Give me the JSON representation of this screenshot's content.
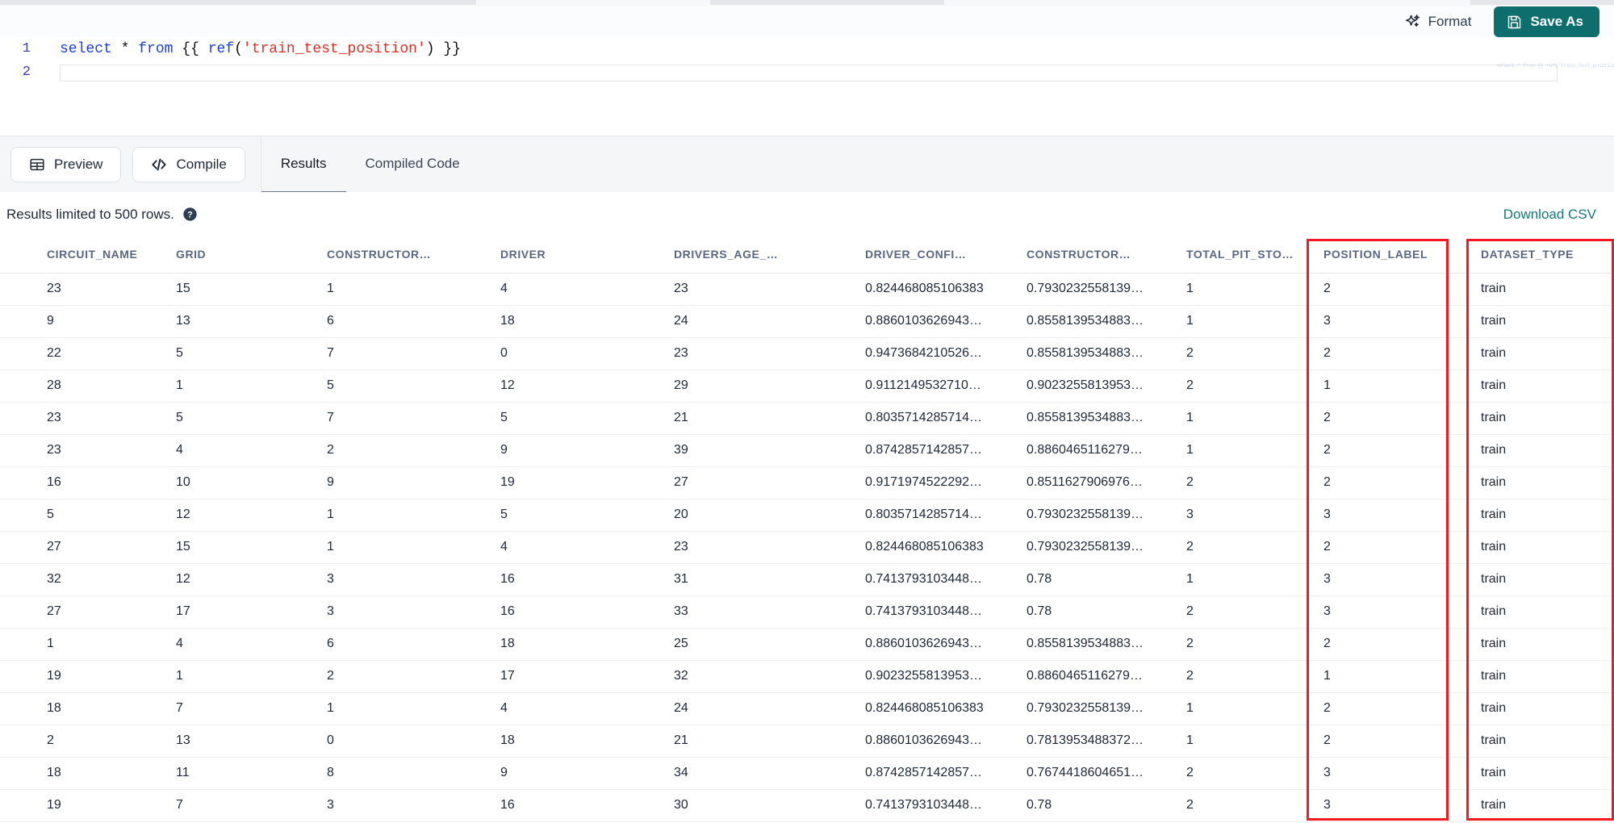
{
  "editor": {
    "toolbar": {
      "format_label": "Format",
      "format_icon": "sparkle-icon",
      "save_as_label": "Save As",
      "save_as_icon": "floppy-disk-icon",
      "accent_color": "#0e6e6e"
    },
    "lines": [
      {
        "number": "1"
      },
      {
        "number": "2"
      }
    ],
    "sql": {
      "kw_select": "select",
      "op_star": "*",
      "kw_from": "from",
      "open_brace": "{{ ",
      "fn_ref": "ref",
      "paren_open": "(",
      "str_arg": "'train_test_position'",
      "paren_close": ")",
      "close_brace": " }}",
      "full_text": "select * from {{ ref('train_test_position') }}",
      "line2_value": ""
    }
  },
  "actions": {
    "preview_label": "Preview",
    "preview_icon": "table-grid-icon",
    "compile_label": "Compile",
    "compile_icon": "code-brackets-icon"
  },
  "tabs": [
    {
      "label": "Results",
      "active": true
    },
    {
      "label": "Compiled Code",
      "active": false
    }
  ],
  "results_info": {
    "limit_text": "Results limited to 500 rows.",
    "help_icon": "help-circle-icon",
    "download_label": "Download CSV",
    "download_color": "#17757a"
  },
  "table": {
    "columns": [
      "CIRCUIT_NAME",
      "GRID",
      "CONSTRUCTOR…",
      "DRIVER",
      "DRIVERS_AGE_…",
      "DRIVER_CONFI…",
      "CONSTRUCTOR…",
      "TOTAL_PIT_STO…",
      "POSITION_LABEL",
      "DATASET_TYPE"
    ],
    "rows": [
      [
        "23",
        "15",
        "1",
        "4",
        "23",
        "0.824468085106383",
        "0.7930232558139…",
        "1",
        "2",
        "train"
      ],
      [
        "9",
        "13",
        "6",
        "18",
        "24",
        "0.8860103626943…",
        "0.8558139534883…",
        "1",
        "3",
        "train"
      ],
      [
        "22",
        "5",
        "7",
        "0",
        "23",
        "0.9473684210526…",
        "0.8558139534883…",
        "2",
        "2",
        "train"
      ],
      [
        "28",
        "1",
        "5",
        "12",
        "29",
        "0.9112149532710…",
        "0.9023255813953…",
        "2",
        "1",
        "train"
      ],
      [
        "23",
        "5",
        "7",
        "5",
        "21",
        "0.8035714285714…",
        "0.8558139534883…",
        "1",
        "2",
        "train"
      ],
      [
        "23",
        "4",
        "2",
        "9",
        "39",
        "0.8742857142857…",
        "0.8860465116279…",
        "1",
        "2",
        "train"
      ],
      [
        "16",
        "10",
        "9",
        "19",
        "27",
        "0.9171974522292…",
        "0.8511627906976…",
        "2",
        "2",
        "train"
      ],
      [
        "5",
        "12",
        "1",
        "5",
        "20",
        "0.8035714285714…",
        "0.7930232558139…",
        "3",
        "3",
        "train"
      ],
      [
        "27",
        "15",
        "1",
        "4",
        "23",
        "0.824468085106383",
        "0.7930232558139…",
        "2",
        "2",
        "train"
      ],
      [
        "32",
        "12",
        "3",
        "16",
        "31",
        "0.7413793103448…",
        "0.78",
        "1",
        "3",
        "train"
      ],
      [
        "27",
        "17",
        "3",
        "16",
        "33",
        "0.7413793103448…",
        "0.78",
        "2",
        "3",
        "train"
      ],
      [
        "1",
        "4",
        "6",
        "18",
        "25",
        "0.8860103626943…",
        "0.8558139534883…",
        "2",
        "2",
        "train"
      ],
      [
        "19",
        "1",
        "2",
        "17",
        "32",
        "0.9023255813953…",
        "0.8860465116279…",
        "2",
        "1",
        "train"
      ],
      [
        "18",
        "7",
        "1",
        "4",
        "24",
        "0.824468085106383",
        "0.7930232558139…",
        "1",
        "2",
        "train"
      ],
      [
        "2",
        "13",
        "0",
        "18",
        "21",
        "0.8860103626943…",
        "0.7813953488372…",
        "1",
        "2",
        "train"
      ],
      [
        "18",
        "11",
        "8",
        "9",
        "34",
        "0.8742857142857…",
        "0.7674418604651…",
        "2",
        "3",
        "train"
      ],
      [
        "19",
        "7",
        "3",
        "16",
        "30",
        "0.7413793103448…",
        "0.78",
        "2",
        "3",
        "train"
      ]
    ]
  },
  "annotations": {
    "color": "#ee1c22",
    "boxes": [
      {
        "target": "POSITION_LABEL"
      },
      {
        "target": "DATASET_TYPE"
      }
    ]
  }
}
